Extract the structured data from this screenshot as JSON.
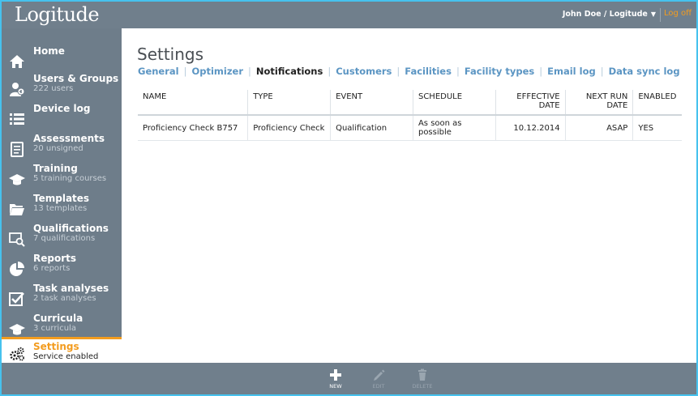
{
  "app": {
    "logo": "Logitude"
  },
  "header": {
    "user": "John Doe / Logitude",
    "logoff": "Log off"
  },
  "sidebar": {
    "items": [
      {
        "label": "Home",
        "sub": ""
      },
      {
        "label": "Users & Groups",
        "sub": "222 users"
      },
      {
        "label": "Device log",
        "sub": ""
      },
      {
        "label": "Assessments",
        "sub": "20 unsigned"
      },
      {
        "label": "Training",
        "sub": "5 training courses"
      },
      {
        "label": "Templates",
        "sub": "13 templates"
      },
      {
        "label": "Qualifications",
        "sub": "7 qualifications"
      },
      {
        "label": "Reports",
        "sub": "6 reports"
      },
      {
        "label": "Task analyses",
        "sub": "2 task analyses"
      },
      {
        "label": "Curricula",
        "sub": "3 curricula"
      },
      {
        "label": "Settings",
        "sub": "Service enabled"
      }
    ]
  },
  "main": {
    "title": "Settings",
    "tabs": [
      "General",
      "Optimizer",
      "Notifications",
      "Customers",
      "Facilities",
      "Facility types",
      "Email log",
      "Data sync log"
    ],
    "table": {
      "headers": [
        "NAME",
        "TYPE",
        "EVENT",
        "SCHEDULE",
        "EFFECTIVE DATE",
        "NEXT RUN DATE",
        "ENABLED"
      ],
      "rows": [
        [
          "Proficiency Check B757",
          "Proficiency Check",
          "Qualification",
          "As soon as possible",
          "10.12.2014",
          "ASAP",
          "YES"
        ]
      ]
    }
  },
  "toolbar": {
    "new": "NEW",
    "edit": "EDIT",
    "delete": "DELETE"
  },
  "colors": {
    "accent": "#f39c1f",
    "sidebar": "#6e7d8a",
    "link": "#5b95c3",
    "border": "#46c2ee"
  }
}
